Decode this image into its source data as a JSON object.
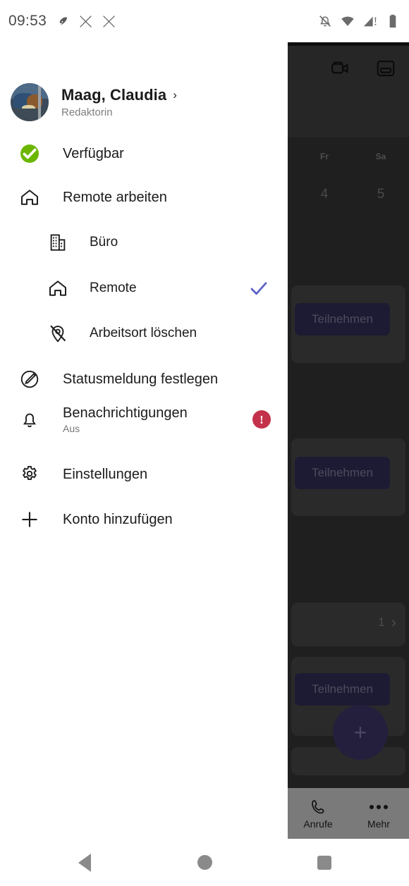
{
  "status_bar": {
    "time": "09:53",
    "left_icons": [
      "avast-icon",
      "x-app-icon",
      "x-app-icon-2"
    ],
    "right_icons": [
      "notifications-muted-icon",
      "wifi-icon",
      "signal-warning-icon",
      "battery-icon"
    ]
  },
  "drawer": {
    "profile": {
      "name": "Maag, Claudia",
      "chevron": "›",
      "subtitle": "Redaktorin",
      "avatar_name": "user-avatar"
    },
    "items": [
      {
        "id": "verfuegbar",
        "label": "Verfügbar",
        "icon": "available-status-icon",
        "level": 0
      },
      {
        "id": "remote-arbeiten",
        "label": "Remote arbeiten",
        "icon": "home-icon",
        "level": 0
      },
      {
        "id": "buero",
        "label": "Büro",
        "icon": "office-building-icon",
        "level": 1
      },
      {
        "id": "remote",
        "label": "Remote",
        "icon": "home-icon",
        "level": 1,
        "selected": true
      },
      {
        "id": "arbeitsort-loeschen",
        "label": "Arbeitsort löschen",
        "icon": "location-off-icon",
        "level": 1
      },
      {
        "id": "statusmeldung",
        "label": "Statusmeldung festlegen",
        "icon": "edit-pencil-icon",
        "level": 0
      },
      {
        "id": "benachrichtigungen",
        "label": "Benachrichtigungen",
        "sublabel": "Aus",
        "icon": "bell-icon",
        "level": 0,
        "badge": "!"
      },
      {
        "id": "einstellungen",
        "label": "Einstellungen",
        "icon": "gear-icon",
        "level": 0
      },
      {
        "id": "konto-hinzufuegen",
        "label": "Konto hinzufügen",
        "icon": "plus-icon",
        "level": 0
      }
    ]
  },
  "background_app": {
    "header_icons": [
      "video-camera-icon",
      "layout-view-icon"
    ],
    "calendar": {
      "day_labels": [
        "Fr",
        "Sa"
      ],
      "day_numbers": [
        "4",
        "5"
      ]
    },
    "join_buttons": [
      "Teilnehmen",
      "Teilnehmen",
      "Teilnehmen"
    ],
    "pager": {
      "count": "1",
      "chevron": "›"
    },
    "fab_label": "+",
    "bottom_nav": [
      {
        "id": "anrufe",
        "label": "Anrufe",
        "icon": "phone-icon"
      },
      {
        "id": "mehr",
        "label": "Mehr",
        "icon": "more-dots-icon"
      }
    ]
  },
  "android_nav": {
    "back": "back-button",
    "home": "home-button",
    "recents": "recents-button"
  },
  "colors": {
    "accent_purple": "#5b5fc7",
    "available_green": "#6bb700",
    "badge_red": "#c4314b",
    "overlay_dark": "#1f1f1f"
  }
}
